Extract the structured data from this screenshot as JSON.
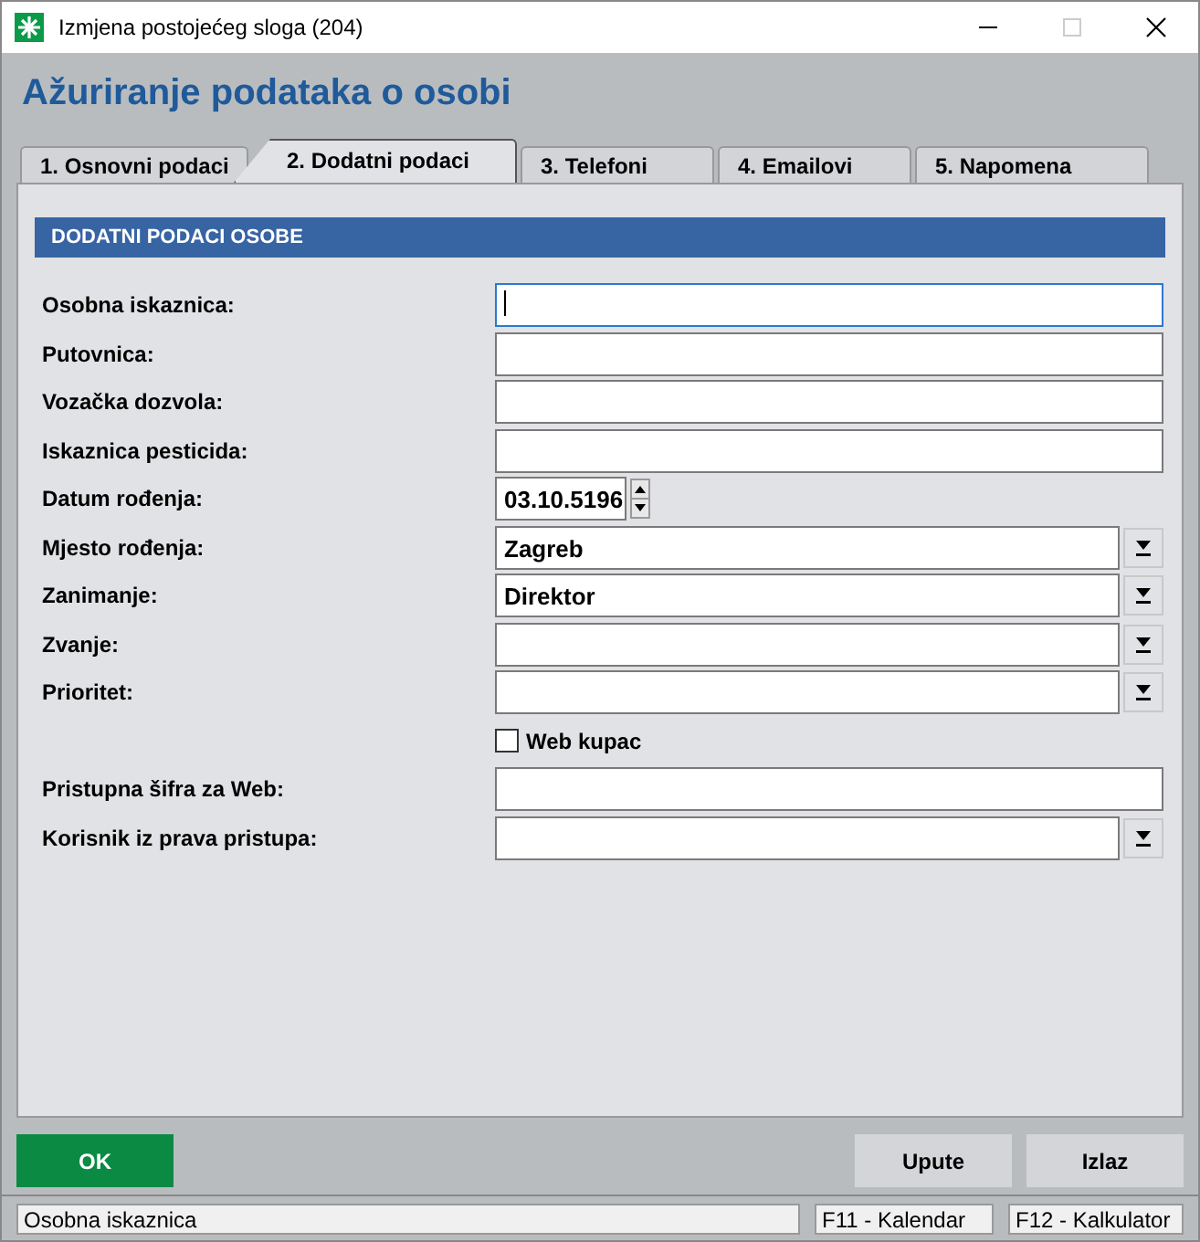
{
  "window": {
    "title": "Izmjena postojećeg sloga (204)"
  },
  "heading": "Ažuriranje podataka o osobi",
  "tabs": [
    {
      "label": "1. Osnovni podaci",
      "selected": false
    },
    {
      "label": "2. Dodatni podaci",
      "selected": true
    },
    {
      "label": "3. Telefoni",
      "selected": false
    },
    {
      "label": "4. Emailovi",
      "selected": false
    },
    {
      "label": "5. Napomena",
      "selected": false
    }
  ],
  "section_title": "DODATNI PODACI OSOBE",
  "fields": [
    {
      "kind": "text",
      "label": "Osobna iskaznica:",
      "focused": true
    },
    {
      "kind": "text",
      "label": "Putovnica:",
      "focused": false
    },
    {
      "kind": "text",
      "label": "Vozačka dozvola:",
      "focused": false
    },
    {
      "kind": "text",
      "label": "Iskaznica pesticida:",
      "focused": false
    },
    {
      "kind": "date",
      "label": "Datum rođenja:",
      "value": "03.10.5196",
      "focused": false
    },
    {
      "kind": "combo",
      "label": "Mjesto rođenja:",
      "value": "Zagreb",
      "focused": false
    },
    {
      "kind": "combo",
      "label": "Zanimanje:",
      "value": "Direktor",
      "focused": false
    },
    {
      "kind": "combo",
      "label": "Zvanje:",
      "focused": false
    },
    {
      "kind": "combo",
      "label": "Prioritet:",
      "focused": false
    },
    {
      "kind": "checkbox",
      "label": "Web kupac",
      "checked": false
    },
    {
      "kind": "text",
      "label": "Pristupna šifra za Web:",
      "focused": false
    },
    {
      "kind": "combo",
      "label": "Korisnik iz prava pristupa:",
      "focused": false
    }
  ],
  "buttons": {
    "ok": "OK",
    "help": "Upute",
    "exit": "Izlaz"
  },
  "status_bar": [
    "Osobna iskaznica",
    "F11 - Kalendar",
    "F12 - Kalkulator"
  ]
}
